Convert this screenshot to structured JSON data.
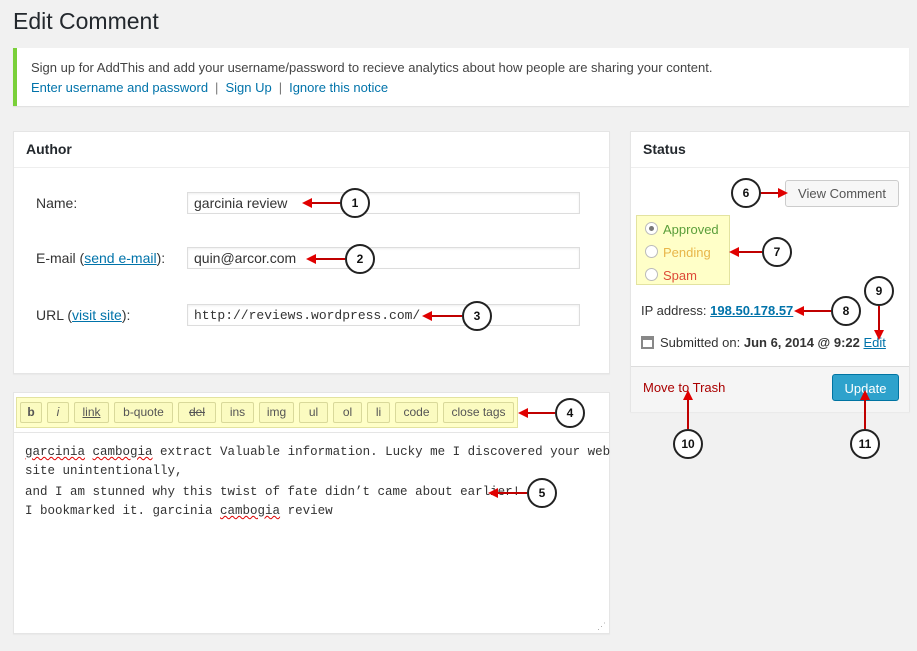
{
  "page_title": "Edit Comment",
  "notice": {
    "message": "Sign up for AddThis and add your username/password to recieve analytics about how people are sharing your content.",
    "links": [
      "Enter username and password",
      "Sign Up",
      "Ignore this notice"
    ],
    "separator": "|"
  },
  "author": {
    "title": "Author",
    "name_label": "Name:",
    "name_value": "garcinia review",
    "email_label_pre": "E-mail (",
    "email_link": "send e-mail",
    "email_label_post": "):",
    "email_value": "quin@arcor.com",
    "url_label_pre": "URL (",
    "url_link": "visit site",
    "url_label_post": "):",
    "url_value": "http://reviews.wordpress.com/"
  },
  "toolbar": {
    "buttons": [
      "b",
      "i",
      "link",
      "b-quote",
      "del",
      "ins",
      "img",
      "ul",
      "ol",
      "li",
      "code",
      "close tags"
    ]
  },
  "editor": {
    "lines": [
      {
        "parts": [
          [
            "garcinia",
            true
          ],
          [
            " ",
            false
          ],
          [
            "cambogia",
            true
          ],
          [
            " extract Valuable information. Lucky me I discovered your web",
            false
          ]
        ]
      },
      {
        "parts": [
          [
            "site unintentionally,",
            false
          ]
        ]
      },
      {
        "parts": [
          [
            "and I am stunned why this twist of fate didn’t came about earlier!",
            false
          ]
        ]
      },
      {
        "parts": [
          [
            "I bookmarked it. garcinia ",
            false
          ],
          [
            "cambogia",
            true
          ],
          [
            " review",
            false
          ]
        ]
      }
    ]
  },
  "status": {
    "title": "Status",
    "view_comment": "View Comment",
    "options": [
      {
        "label": "Approved",
        "checked": true,
        "color": "#5a9e3a"
      },
      {
        "label": "Pending",
        "checked": false,
        "color": "#e8b64a"
      },
      {
        "label": "Spam",
        "checked": false,
        "color": "#dd4b39"
      }
    ],
    "ip_label": "IP address:",
    "ip_value": "198.50.178.57",
    "submitted_label": "Submitted on:",
    "submitted_value": "Jun 6, 2014 @ 9:22",
    "edit_link": "Edit",
    "trash_label": "Move to Trash",
    "update_label": "Update"
  },
  "callouts": [
    "1",
    "2",
    "3",
    "4",
    "5",
    "6",
    "7",
    "8",
    "9",
    "10",
    "11"
  ],
  "colors": {
    "accent": "#0073aa",
    "update_btn": "#2ea2cc",
    "trash": "#a00",
    "arrow": "#e00000",
    "highlight": "#ffffc8"
  }
}
